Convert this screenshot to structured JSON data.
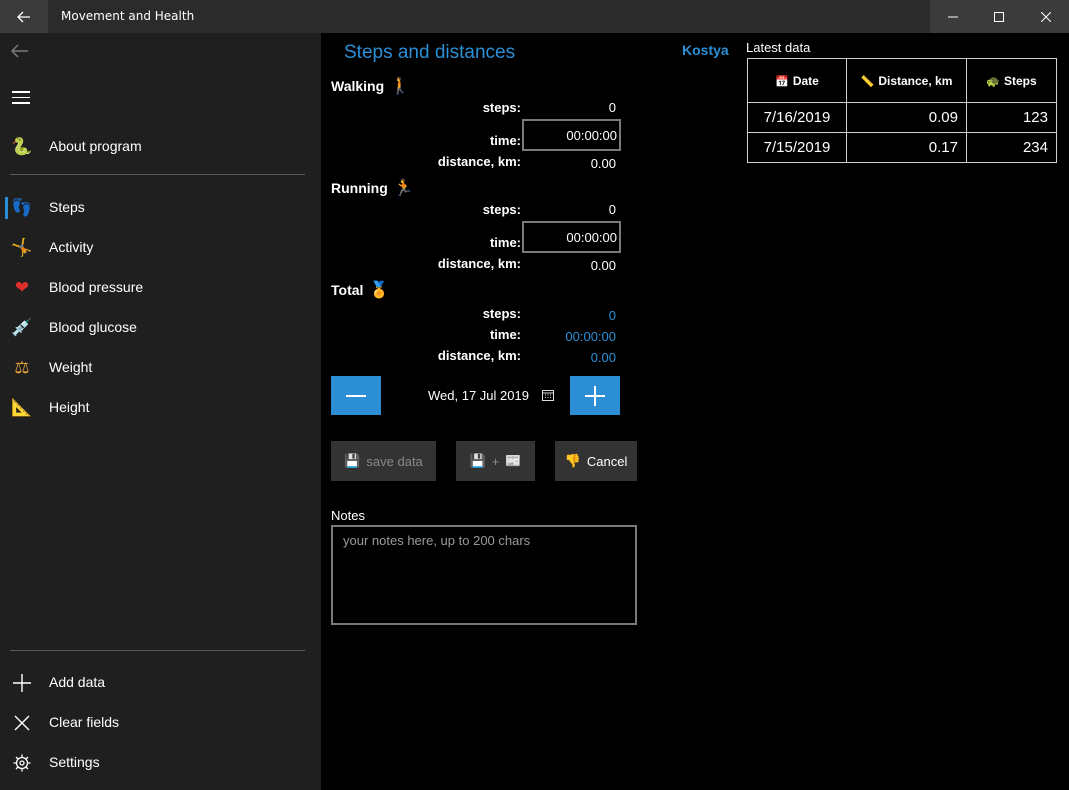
{
  "window": {
    "title": "Movement and Health"
  },
  "nav": {
    "items": [
      {
        "label": "About program",
        "icon": "snake-icon"
      },
      {
        "label": "Steps",
        "icon": "footprints-icon",
        "selected": true
      },
      {
        "label": "Activity",
        "icon": "cartwheel-icon"
      },
      {
        "label": "Blood pressure",
        "icon": "heart-icon"
      },
      {
        "label": "Blood glucose",
        "icon": "syringe-icon"
      },
      {
        "label": "Weight",
        "icon": "scales-icon"
      },
      {
        "label": "Height",
        "icon": "triangular-ruler-icon"
      }
    ],
    "footer": [
      {
        "label": "Add data",
        "icon": "plus-icon"
      },
      {
        "label": "Clear fields",
        "icon": "close-icon"
      },
      {
        "label": "Settings",
        "icon": "gear-icon"
      }
    ]
  },
  "main": {
    "title": "Steps and distances",
    "user": "Kostya",
    "walking": {
      "heading": "Walking",
      "steps_label": "steps:",
      "steps": "0",
      "time_label": "time:",
      "time": "00:00:00",
      "distance_label": "distance, km:",
      "distance": "0.00"
    },
    "running": {
      "heading": "Running",
      "steps_label": "steps:",
      "steps": "0",
      "time_label": "time:",
      "time": "00:00:00",
      "distance_label": "distance, km:",
      "distance": "0.00"
    },
    "total": {
      "heading": "Total",
      "steps_label": "steps:",
      "steps": "0",
      "time_label": "time:",
      "time": "00:00:00",
      "distance_label": "distance, km:",
      "distance": "0.00"
    },
    "date": "Wed, 17 Jul 2019",
    "buttons": {
      "save": "save data",
      "save_plus": "+",
      "cancel": "Cancel"
    },
    "notes": {
      "label": "Notes",
      "placeholder": "your notes here, up to 200 chars"
    }
  },
  "latest": {
    "title": "Latest data",
    "columns": [
      "Date",
      "Distance, km",
      "Steps"
    ],
    "rows": [
      [
        "7/16/2019",
        "0.09",
        "123"
      ],
      [
        "7/15/2019",
        "0.17",
        "234"
      ]
    ]
  },
  "colors": {
    "accent": "#2c8fd6",
    "sidebar": "#1f1f1f",
    "titlebar": "#2b2b2b",
    "button": "#333333"
  }
}
